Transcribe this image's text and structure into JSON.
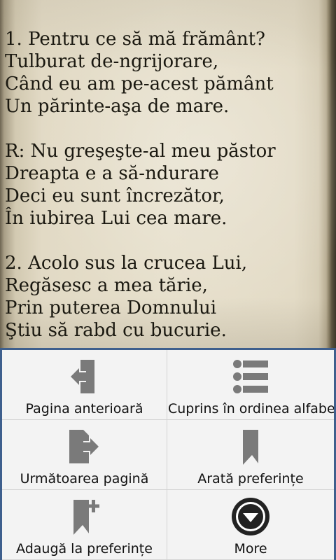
{
  "song": {
    "lines": [
      "1. Pentru ce să mă frământ?",
      "Tulburat de-ngrijorare,",
      "Când eu am pe-acest pământ",
      "Un părinte-aşa de mare.",
      "",
      "R: Nu greşeşte-al meu păstor",
      "Dreapta e a să-ndurare",
      "Deci eu sunt încrezător,",
      "În iubirea Lui cea mare.",
      "",
      "2. Acolo sus la crucea Lui,",
      "Regăsesc a mea tărie,",
      "Prin puterea Domnului",
      "Ştiu să rabd cu bucurie."
    ]
  },
  "menu": {
    "items": [
      {
        "label": "Pagina anterioară",
        "icon": "previous-page-icon"
      },
      {
        "label": "Cuprins în ordinea alfabetică",
        "icon": "list-icon"
      },
      {
        "label": "Următoarea pagină",
        "icon": "next-page-icon"
      },
      {
        "label": "Arată preferințe",
        "icon": "bookmark-icon"
      },
      {
        "label": "Adaugă la preferințe",
        "icon": "add-bookmark-icon"
      },
      {
        "label": "More",
        "icon": "more-icon"
      }
    ]
  },
  "colors": {
    "menu_border": "#3e5f8d",
    "menu_background": "#f3f3f3",
    "icon_gray": "#7a7a7a",
    "lyrics_text": "#1a1810"
  }
}
